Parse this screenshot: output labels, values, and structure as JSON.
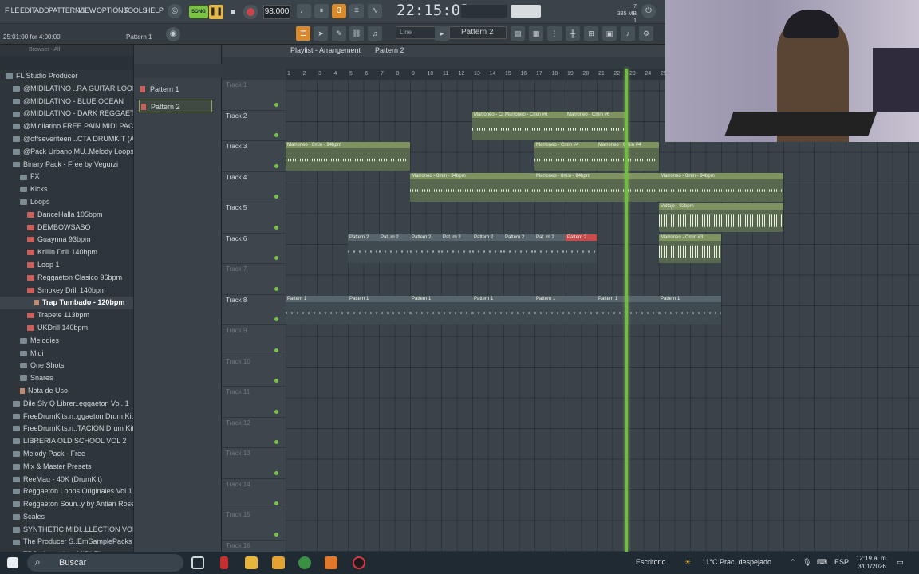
{
  "menu": [
    "FILE",
    "EDIT",
    "ADD",
    "PATTERNS",
    "VIEW",
    "OPTIONS",
    "TOOLS",
    "HELP"
  ],
  "transport": {
    "song_label": "SONG",
    "tempo": "98.000",
    "time": "22:15:03",
    "cpu_top": "7",
    "mem": "335 MB",
    "cpu_bottom": "1"
  },
  "hint_text": "25:01:00 for 4:00:00",
  "hint_pattern": "Pattern 1",
  "pattern_selector": "Pattern 2",
  "snap_selector": "Line",
  "browser": {
    "header": "Browser - All",
    "items": [
      {
        "label": "FL Studio Producer",
        "kind": "folder",
        "indent": 1
      },
      {
        "label": "@MIDILATINO ..RA GUITAR LOOPS",
        "kind": "folder",
        "indent": 2
      },
      {
        "label": "@MIDILATINO - BLUE OCEAN",
        "kind": "folder",
        "indent": 2
      },
      {
        "label": "@MIDILATINO - DARK REGGAETON",
        "kind": "folder",
        "indent": 2
      },
      {
        "label": "@Midilatino FREE PAIN MIDI PACK",
        "kind": "folder",
        "indent": 2
      },
      {
        "label": "@offseventeen ..CTA DRUMKIT (A)",
        "kind": "folder",
        "indent": 2
      },
      {
        "label": "@Pack Urbano MU..Melody Loops",
        "kind": "folder",
        "indent": 2
      },
      {
        "label": "Binary Pack - Free by Vegurzi",
        "kind": "folder",
        "indent": 2
      },
      {
        "label": "FX",
        "kind": "folder",
        "indent": 3
      },
      {
        "label": "Kicks",
        "kind": "folder",
        "indent": 3
      },
      {
        "label": "Loops",
        "kind": "folder",
        "indent": 3
      },
      {
        "label": "DanceHalla 105bpm",
        "kind": "pack",
        "indent": 4
      },
      {
        "label": "DEMBOWSASO",
        "kind": "pack",
        "indent": 4
      },
      {
        "label": "Guaynna 93bpm",
        "kind": "pack",
        "indent": 4
      },
      {
        "label": "Krillin Drill 140bpm",
        "kind": "pack",
        "indent": 4
      },
      {
        "label": "Loop 1",
        "kind": "pack",
        "indent": 4
      },
      {
        "label": "Reggaeton Clasico 96bpm",
        "kind": "pack",
        "indent": 4
      },
      {
        "label": "Smokey Drill 140bpm",
        "kind": "pack",
        "indent": 4
      },
      {
        "label": "Trap Tumbado - 120bpm",
        "kind": "file",
        "indent": 5,
        "selected": true
      },
      {
        "label": "Trapete 113bpm",
        "kind": "pack",
        "indent": 4
      },
      {
        "label": "UKDrill 140bpm",
        "kind": "pack",
        "indent": 4
      },
      {
        "label": "Melodies",
        "kind": "folder",
        "indent": 3
      },
      {
        "label": "Midi",
        "kind": "folder",
        "indent": 3
      },
      {
        "label": "One Shots",
        "kind": "folder",
        "indent": 3
      },
      {
        "label": "Snares",
        "kind": "folder",
        "indent": 3
      },
      {
        "label": "Nota de Uso",
        "kind": "file",
        "indent": 3
      },
      {
        "label": "Dile Sly Q Librer..eggaeton Vol. 1",
        "kind": "folder",
        "indent": 2
      },
      {
        "label": "FreeDrumKits.n..ggaeton Drum Kit",
        "kind": "folder",
        "indent": 2
      },
      {
        "label": "FreeDrumKits.n..TACION Drum Kit",
        "kind": "folder",
        "indent": 2
      },
      {
        "label": "LIBRERIA OLD SCHOOL VOL 2",
        "kind": "folder",
        "indent": 2
      },
      {
        "label": "Melody Pack - Free",
        "kind": "folder",
        "indent": 2
      },
      {
        "label": "Mix & Master Presets",
        "kind": "folder",
        "indent": 2
      },
      {
        "label": "ReeMau - 40K (DrumKit)",
        "kind": "folder",
        "indent": 2
      },
      {
        "label": "Reggaeton Loops Originales Vol.1",
        "kind": "folder",
        "indent": 2
      },
      {
        "label": "Reggaeton Soun..y by Antian Rose",
        "kind": "folder",
        "indent": 2
      },
      {
        "label": "Scales",
        "kind": "folder",
        "indent": 2
      },
      {
        "label": "SYNTHETIC MIDI..LLECTION VOL. 3",
        "kind": "folder",
        "indent": 2
      },
      {
        "label": "The Producer S..EmSamplePacks",
        "kind": "folder",
        "indent": 2
      },
      {
        "label": "TPS - Intensity - MIDI Files",
        "kind": "folder",
        "indent": 2
      }
    ]
  },
  "picker": [
    "Pattern 1",
    "Pattern 2"
  ],
  "playlist": {
    "title": "Playlist - Arrangement",
    "title_pattern": "Pattern 2",
    "ruler": [
      "1",
      "2",
      "3",
      "4",
      "5",
      "6",
      "7",
      "8",
      "9",
      "10",
      "11",
      "12",
      "13",
      "14",
      "15",
      "16",
      "17",
      "18",
      "19",
      "20",
      "21",
      "22",
      "23",
      "24",
      "25"
    ],
    "tracks": [
      "Track 1",
      "Track 2",
      "Track 3",
      "Track 4",
      "Track 5",
      "Track 6",
      "Track 7",
      "Track 8",
      "Track 9",
      "Track 10",
      "Track 11",
      "Track 12",
      "Track 13",
      "Track 14",
      "Track 15",
      "Track 16"
    ],
    "clips": [
      {
        "track": 2,
        "start": 13,
        "len": 2,
        "label": "Marroneo - Cmin #6",
        "type": "audio"
      },
      {
        "track": 2,
        "start": 15,
        "len": 4,
        "label": "Marroneo - Cmin #6",
        "type": "audio"
      },
      {
        "track": 2,
        "start": 19,
        "len": 4,
        "label": "Marroneo - Cmin #6",
        "type": "audio"
      },
      {
        "track": 3,
        "start": 1,
        "len": 8,
        "label": "Marroneo - 8min - 94bpm",
        "type": "audio"
      },
      {
        "track": 3,
        "start": 17,
        "len": 4,
        "label": "Marroneo - Cmin #4",
        "type": "audio"
      },
      {
        "track": 3,
        "start": 21,
        "len": 4,
        "label": "Marroneo - Cmin #4",
        "type": "audio"
      },
      {
        "track": 4,
        "start": 9,
        "len": 8,
        "label": "Marroneo - 8min - 94bpm",
        "type": "audio"
      },
      {
        "track": 4,
        "start": 17,
        "len": 8,
        "label": "Marroneo - 8min - 94bpm",
        "type": "audio"
      },
      {
        "track": 4,
        "start": 25,
        "len": 8,
        "label": "Marroneo - 8min - 94bpm",
        "type": "audio"
      },
      {
        "track": 5,
        "start": 25,
        "len": 8,
        "label": "Voltaje - 92bpm",
        "type": "tall"
      },
      {
        "track": 6,
        "start": 5,
        "len": 2,
        "label": "Pattern 2",
        "type": "pattern"
      },
      {
        "track": 6,
        "start": 7,
        "len": 2,
        "label": "Pat..rn 2",
        "type": "pattern"
      },
      {
        "track": 6,
        "start": 9,
        "len": 2,
        "label": "Pattern 2",
        "type": "pattern"
      },
      {
        "track": 6,
        "start": 11,
        "len": 2,
        "label": "Pat..rn 2",
        "type": "pattern"
      },
      {
        "track": 6,
        "start": 13,
        "len": 2,
        "label": "Pattern 2",
        "type": "pattern"
      },
      {
        "track": 6,
        "start": 15,
        "len": 2,
        "label": "Pattern 2",
        "type": "pattern"
      },
      {
        "track": 6,
        "start": 17,
        "len": 2,
        "label": "Pat..rn 2",
        "type": "pattern"
      },
      {
        "track": 6,
        "start": 19,
        "len": 2,
        "label": "Pattern 2",
        "type": "pattern-red"
      },
      {
        "track": 6,
        "start": 25,
        "len": 4,
        "label": "Marroneo - Cmin #3",
        "type": "tall"
      },
      {
        "track": 8,
        "start": 1,
        "len": 4,
        "label": "Pattern 1",
        "type": "pattern"
      },
      {
        "track": 8,
        "start": 5,
        "len": 4,
        "label": "Pattern 1",
        "type": "pattern"
      },
      {
        "track": 8,
        "start": 9,
        "len": 4,
        "label": "Pattern 1",
        "type": "pattern"
      },
      {
        "track": 8,
        "start": 13,
        "len": 4,
        "label": "Pattern 1",
        "type": "pattern"
      },
      {
        "track": 8,
        "start": 17,
        "len": 4,
        "label": "Pattern 1",
        "type": "pattern"
      },
      {
        "track": 8,
        "start": 21,
        "len": 4,
        "label": "Pattern 1",
        "type": "pattern"
      },
      {
        "track": 8,
        "start": 25,
        "len": 4,
        "label": "Pattern 1",
        "type": "pattern"
      }
    ]
  },
  "taskbar": {
    "search": "Buscar",
    "desktop": "Escritorio",
    "weather": "11°C  Prac. despejado",
    "lang": "ESP",
    "time": "12:19 a. m.",
    "date": "3/01/2026"
  }
}
